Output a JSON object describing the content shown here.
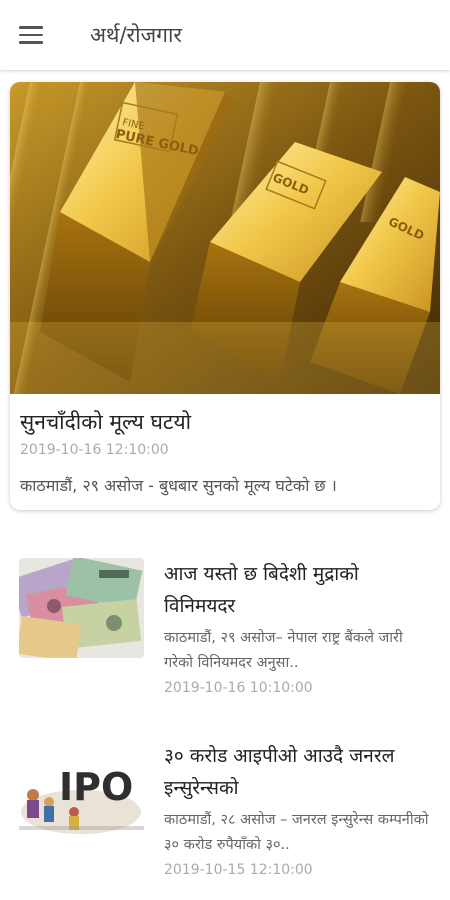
{
  "appbar": {
    "title": "अर्थ/रोजगार",
    "menu_icon": "hamburger-menu-icon"
  },
  "featured": {
    "title": "सुनचाँदीको मूल्य घटयो",
    "date": "2019-10-16 12:10:00",
    "summary": "काठमाडौं, २९ असोज  - बुधबार सुनको मूल्य घटेको छ ।",
    "image_label": "PURE GOLD"
  },
  "news": [
    {
      "title": "आज यस्तो छ बिदेशी मुद्राको विनिमयदर",
      "summary": "काठमाडौं, २९ असोज– नेपाल राष्ट्र बैंकले जारी गरेको विनियमदर अनुसा..",
      "date": "2019-10-16 10:10:00"
    },
    {
      "title": "३० करोड आइपीओ आउदै जनरल इन्सुरेन्सको",
      "summary": "काठमाडौं, २८ असोज – जनरल इन्सुरेन्स कम्पनीको ३० करोड रुपैयाँको ३०..",
      "date": "2019-10-15 12:10:00",
      "image_text": "IPO"
    }
  ],
  "colors": {
    "gold_light": "#f6d36a",
    "gold_dark": "#8a6410",
    "date_gray": "#aaaaaa"
  }
}
